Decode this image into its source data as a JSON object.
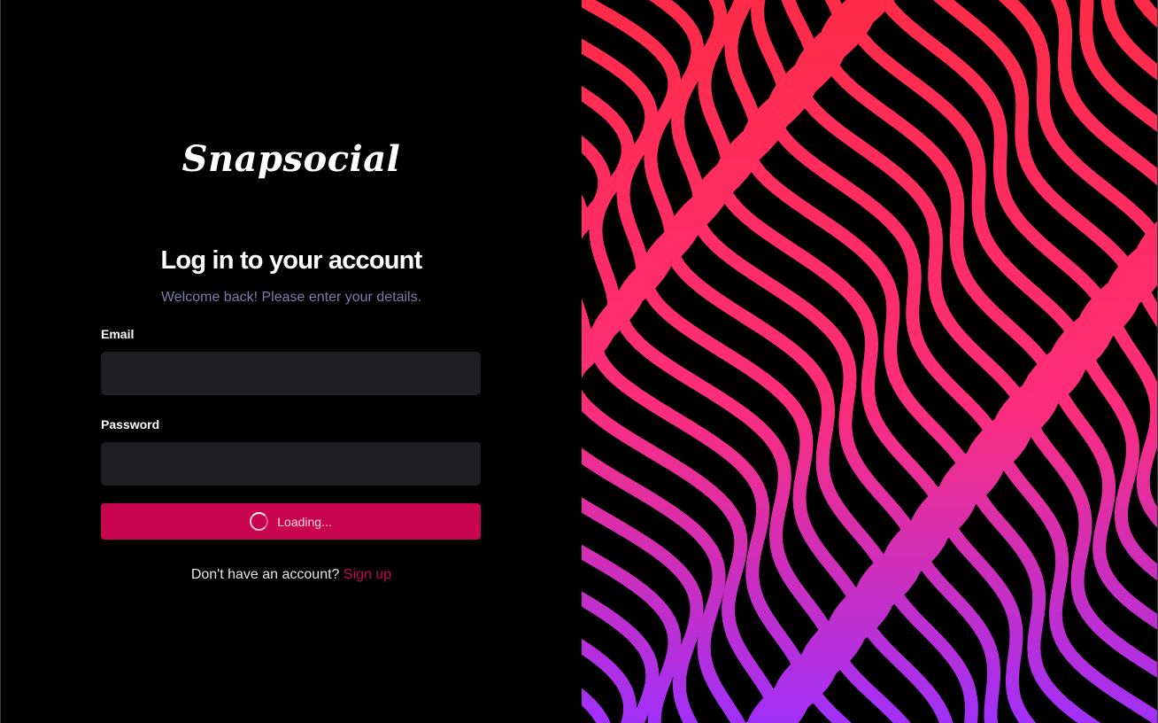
{
  "brand": {
    "logo_text": "Snapsocial"
  },
  "login": {
    "title": "Log in to your account",
    "subtitle": "Welcome back! Please enter your details.",
    "email_label": "Email",
    "email_value": "",
    "password_label": "Password",
    "password_value": "",
    "submit_label": "Loading...",
    "signup_prompt": "Don't have an account?",
    "signup_link": "Sign up"
  },
  "colors": {
    "accent": "#c8044f",
    "subtitle": "#7c7ba9",
    "input_bg": "#1f1f22",
    "wave_top": "#ff2b45",
    "wave_middle": "#ff2d7a",
    "wave_bottom": "#9b30ff"
  },
  "icons": {
    "loading": "spinner-icon"
  }
}
